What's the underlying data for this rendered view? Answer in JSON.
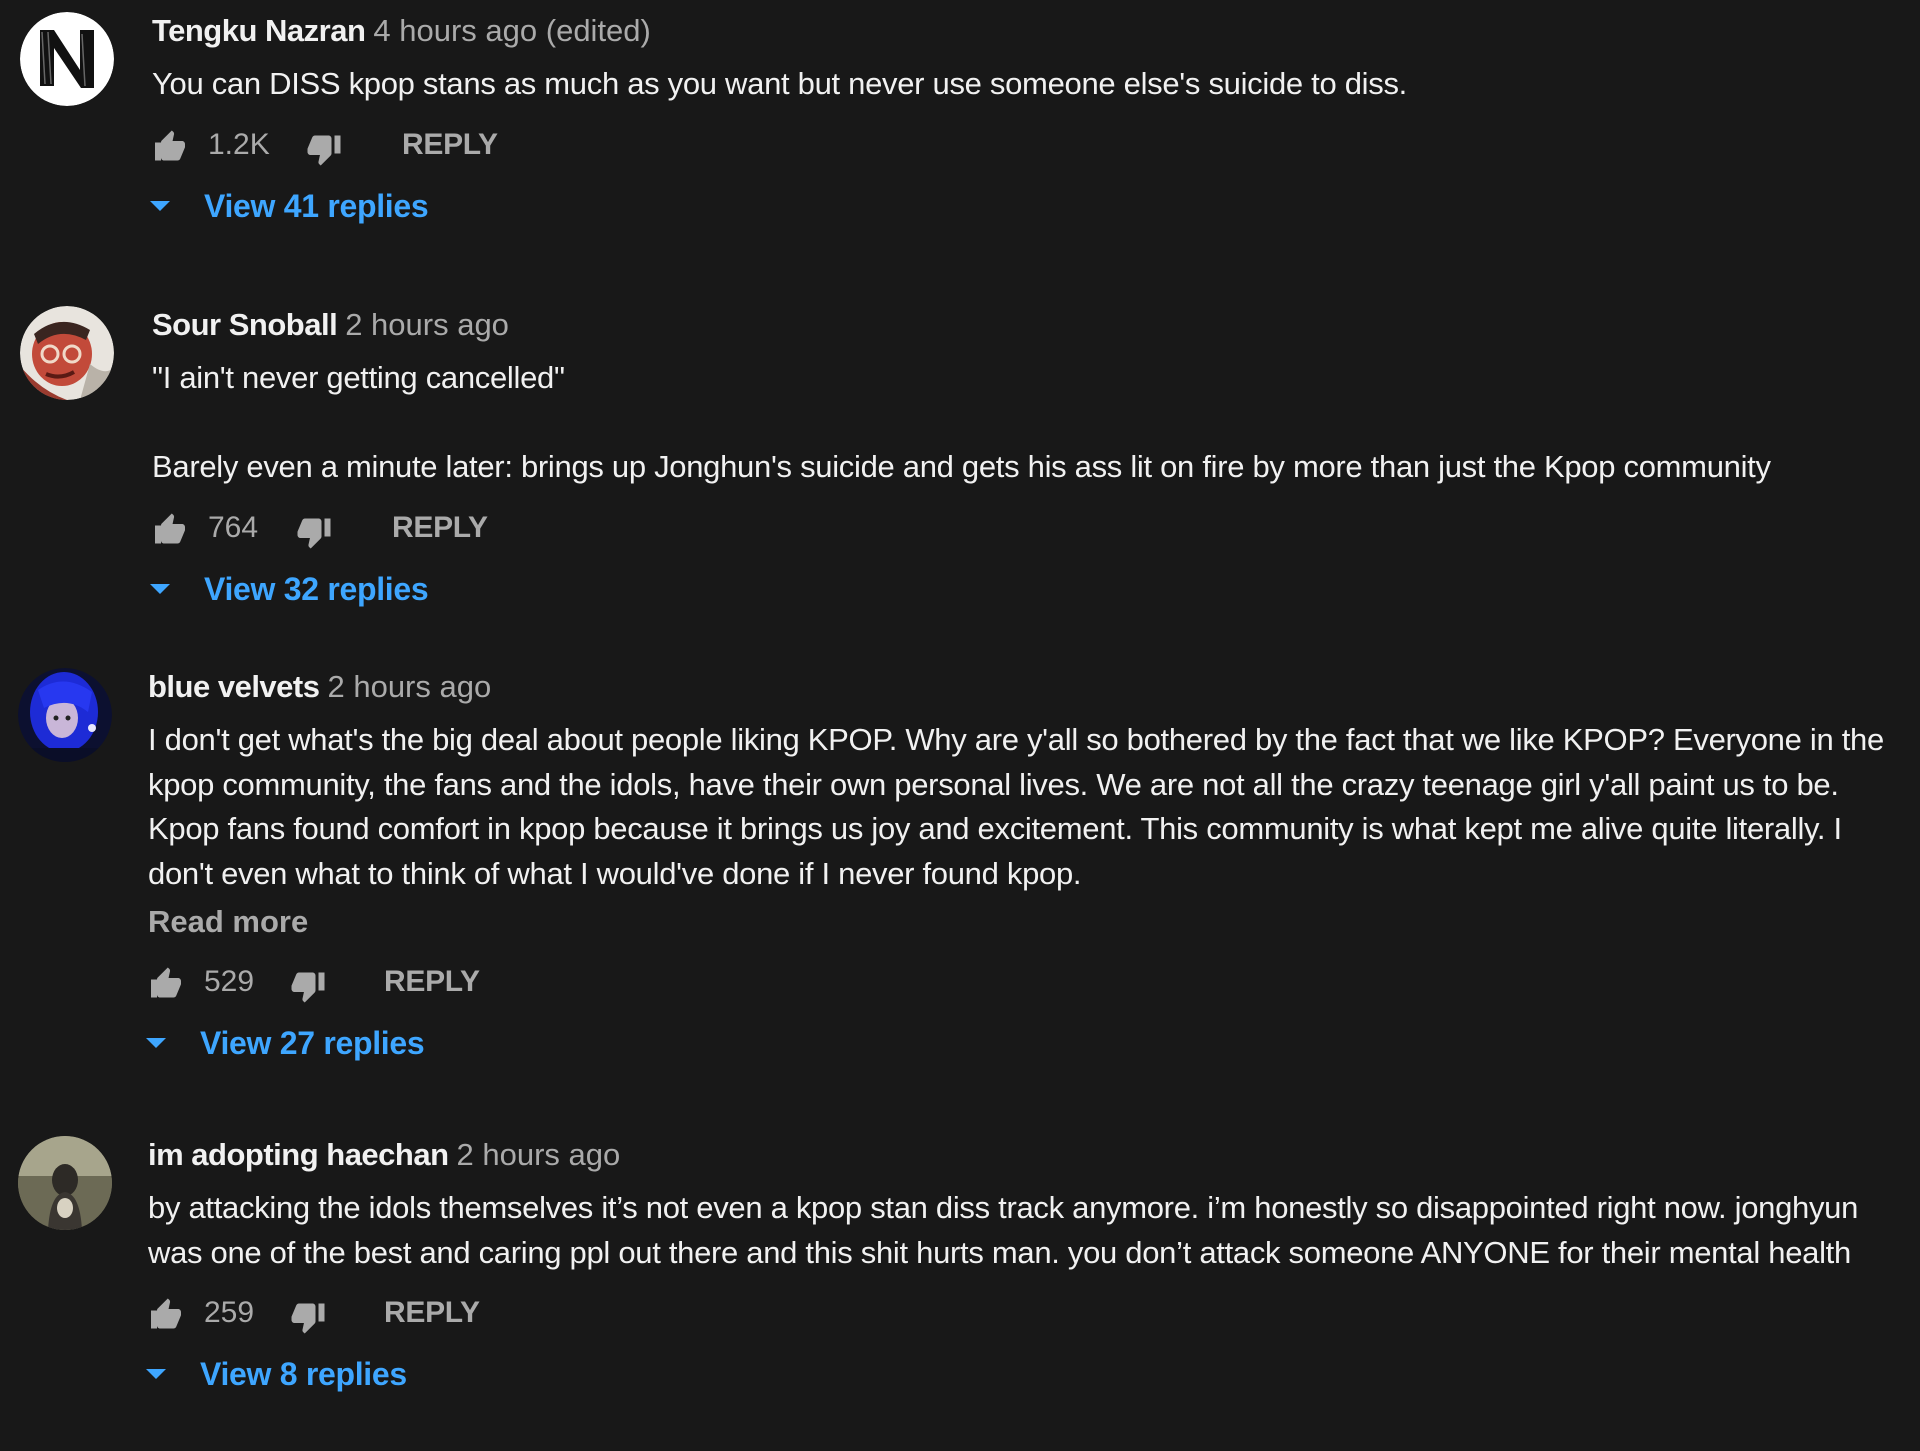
{
  "theme": {
    "background": "#181818",
    "text": "#f1f1f1",
    "secondary_text": "#aaaaaa",
    "link_blue": "#3ea6ff"
  },
  "comments": [
    {
      "author": "Tengku Nazran",
      "time": "4 hours ago (edited)",
      "text": "You can DISS kpop stans as much as you want but never use someone else's suicide to diss.",
      "likes": "1.2K",
      "reply_label": "REPLY",
      "view_replies": "View 41 replies",
      "avatar_icon": "n-letter-avatar"
    },
    {
      "author": "Sour Snoball",
      "time": "2 hours ago",
      "text": "\"I ain't never getting cancelled\"\n\nBarely even a minute later: brings up Jonghun's suicide and gets his ass lit on fire by more than just the Kpop community",
      "likes": "764",
      "reply_label": "REPLY",
      "view_replies": "View 32 replies",
      "avatar_icon": "cartoon-character-avatar"
    },
    {
      "author": "blue velvets",
      "time": "2 hours ago",
      "text": "I don't get what's the big deal about people liking KPOP. Why are y'all so bothered by the fact that we like KPOP? Everyone in the kpop community, the fans and the idols, have their own personal lives. We are not all the crazy teenage girl y'all paint us to be. Kpop fans found comfort in kpop because it brings us joy and excitement. This community is what kept me alive quite literally. I don't even what to think of what I would've done if I never found kpop.",
      "read_more": "Read more",
      "likes": "529",
      "reply_label": "REPLY",
      "view_replies": "View 27 replies",
      "avatar_icon": "blue-hair-avatar"
    },
    {
      "author": "im adopting haechan",
      "time": "2 hours ago",
      "text": "by attacking the idols themselves it’s not even a kpop stan diss track anymore. i’m honestly so disappointed right now. jonghyun was one of the best and caring ppl out there and this shit hurts man. you don’t attack someone ANYONE for their mental health",
      "likes": "259",
      "reply_label": "REPLY",
      "view_replies": "View 8 replies",
      "avatar_icon": "person-photo-avatar"
    }
  ]
}
